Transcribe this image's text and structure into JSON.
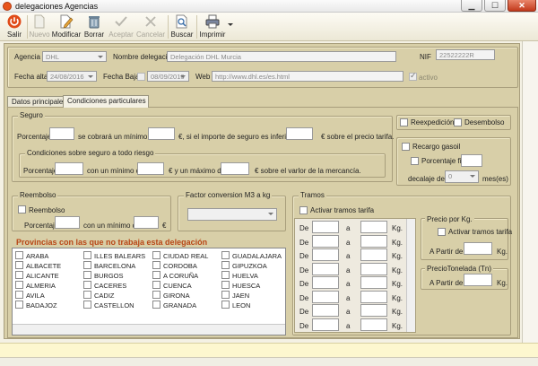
{
  "window": {
    "title": "delegaciones Agencias"
  },
  "toolbar": {
    "salir": "Salir",
    "nuevo": "Nuevo",
    "modificar": "Modificar",
    "borrar": "Borrar",
    "aceptar": "Aceptar",
    "cancelar": "Cancelar",
    "buscar": "Buscar",
    "imprimir": "Imprimir"
  },
  "header": {
    "agencia_label": "Agencia",
    "agencia_value": "DHL",
    "nombre_label": "Nombre delegación",
    "nombre_value": "Delegación DHL Murcia",
    "nif_label": "NIF",
    "nif_value": "22522222R",
    "fecha_alta_label": "Fecha alta",
    "fecha_alta_value": "24/08/2016",
    "fecha_baja_label": "Fecha Baja",
    "fecha_baja_value": "08/09/2016",
    "web_label": "Web",
    "web_value": "http://www.dhl.es/es.html",
    "activo_label": "activo"
  },
  "tabs": [
    "Datos principales",
    "Condiciones particulares"
  ],
  "seguro": {
    "title": "Seguro",
    "porcentaje": "Porcentaje",
    "cobrara": "se cobrará un mínimo de",
    "si_importe": "€, si el importe de seguro es inferior a",
    "sobre_precio": "€ sobre el precio tarifa.",
    "todo_riesgo_title": "Condiciones sobre seguro a todo riesgo",
    "con_minimo": "con un mínimo de",
    "maximo": "€ y un máximo de",
    "sobre_valor": "€ sobre el varlor de la mercancía."
  },
  "reexp": {
    "reexpedicion": "Reexpedición",
    "desembolso": "Desembolso"
  },
  "recargo": {
    "recargo_gasoil": "Recargo gasoil",
    "porcentaje_fijo": "Porcentaje fijo",
    "decalaje": "decalaje de",
    "decalaje_value": "0",
    "meses": "mes(es)"
  },
  "reembolso": {
    "title": "Reembolso",
    "check": "Reembolso",
    "porcentaje": "Porcentaje",
    "con_minimo": "con un mínimo de",
    "euro": "€"
  },
  "factor": {
    "title": "Factor conversion M3 a kg"
  },
  "provincias": {
    "title": "Provincias con las que no trabaja esta delegación",
    "col1": [
      "ARABA",
      "ALBACETE",
      "ALICANTE",
      "ALMERIA",
      "AVILA",
      "BADAJOZ"
    ],
    "col2": [
      "ILLES BALEARS",
      "BARCELONA",
      "BURGOS",
      "CACERES",
      "CADIZ",
      "CASTELLON"
    ],
    "col3": [
      "CIUDAD REAL",
      "CORDOBA",
      "A CORUÑA",
      "CUENCA",
      "GIRONA",
      "GRANADA"
    ],
    "col4": [
      "GUADALAJARA",
      "GIPUZKOA",
      "HUELVA",
      "HUESCA",
      "JAEN",
      "LEON"
    ]
  },
  "tramos": {
    "title": "Tramos",
    "activar": "Activar tramos tarifa",
    "de": "De",
    "a": "a",
    "kg": "Kg.",
    "precio_kg_title": "Precio por Kg.",
    "activar_tramos": "Activar tramos tarifa",
    "a_partir": "A Partir de",
    "precio_ton_title": "PrecioTonelada (Tn)"
  }
}
